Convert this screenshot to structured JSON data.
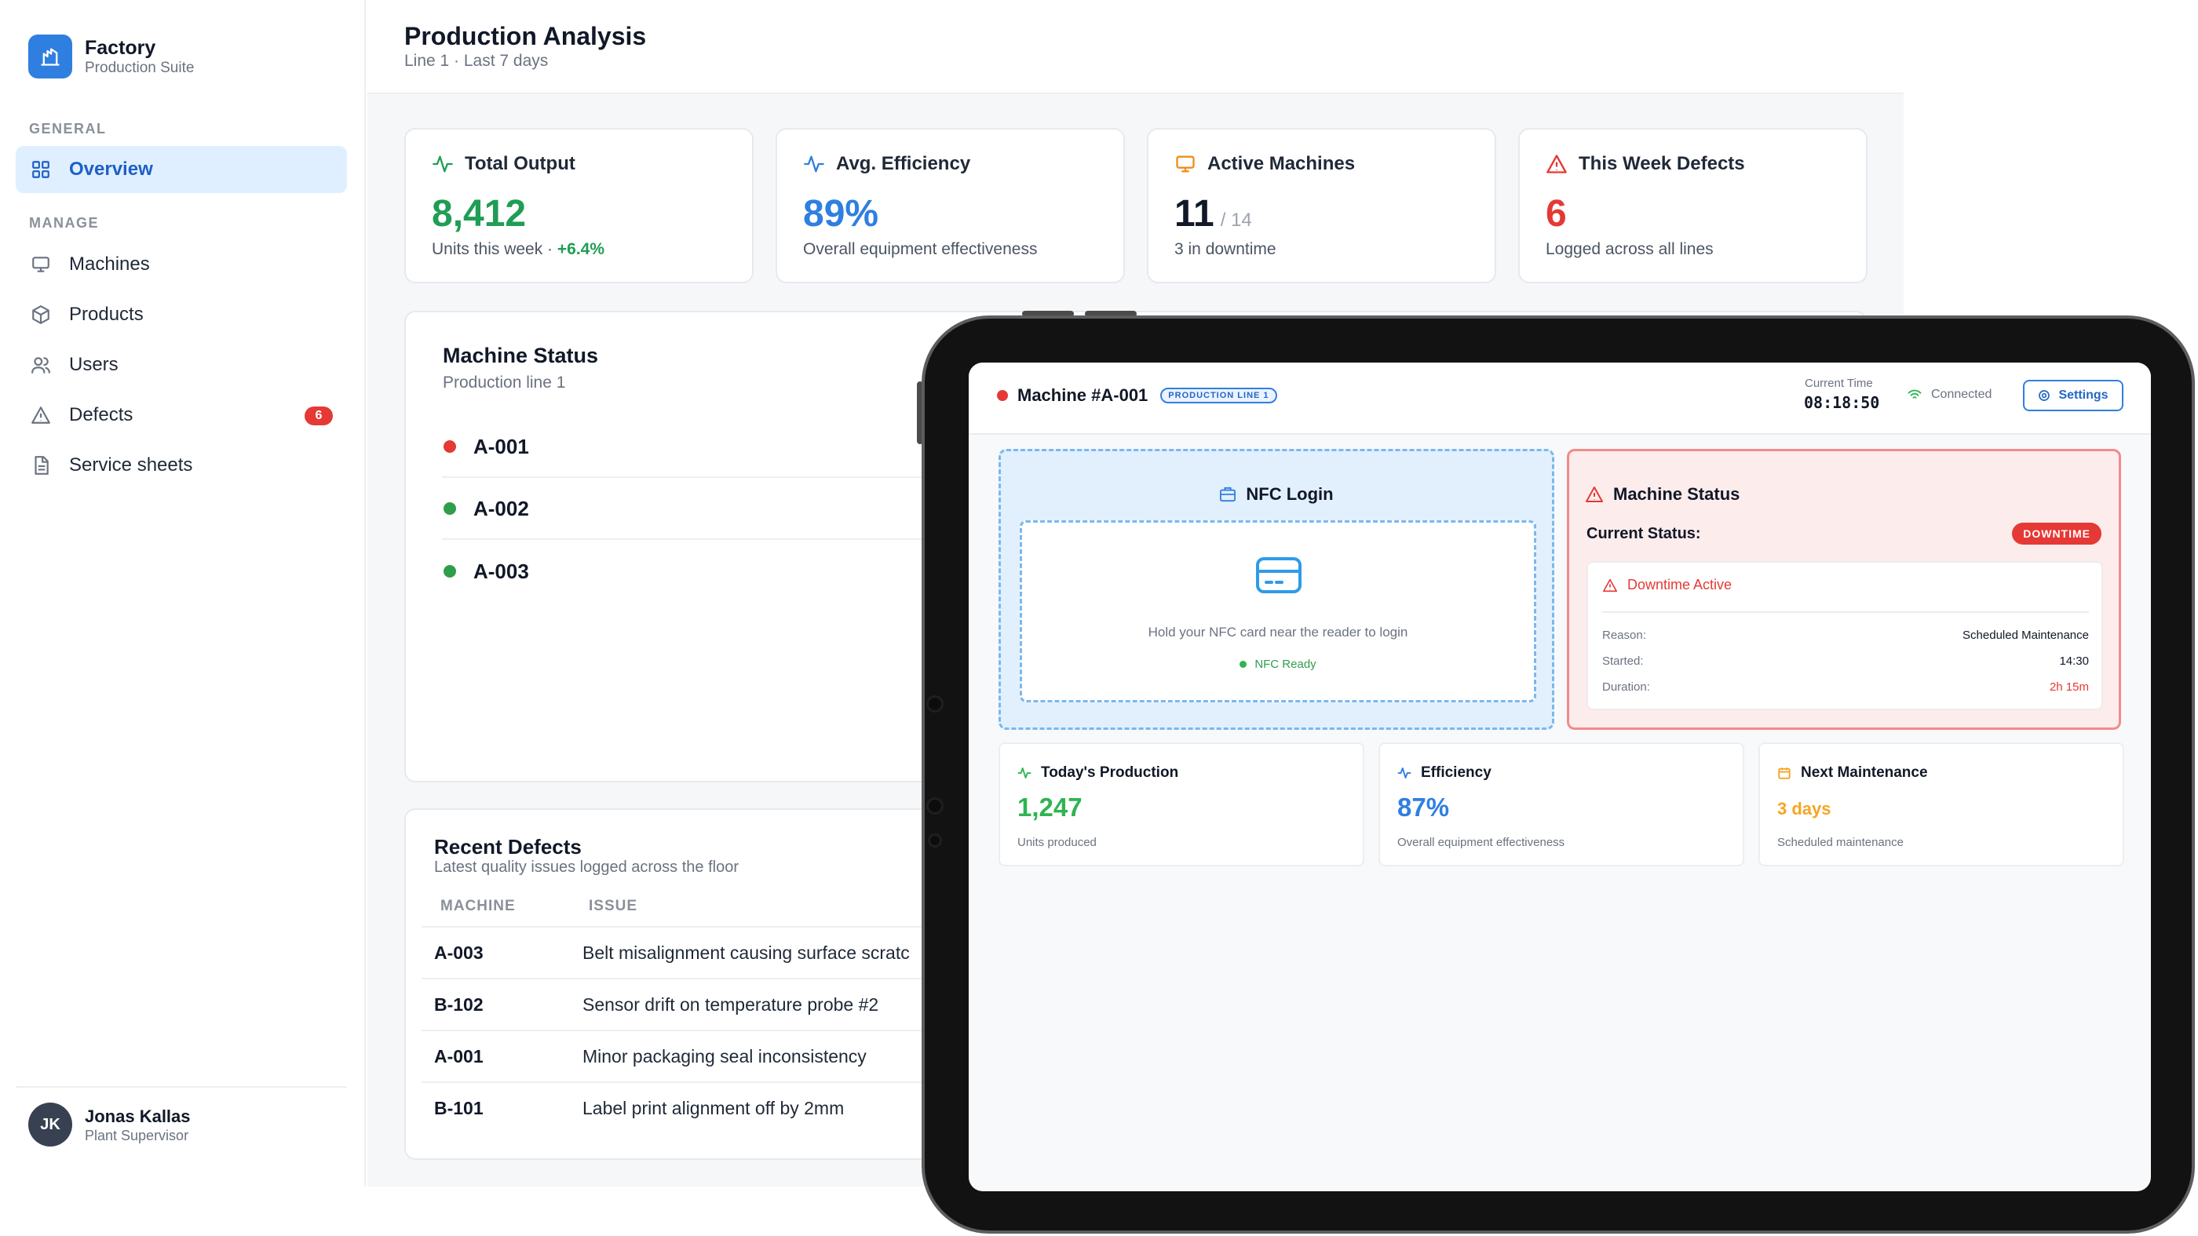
{
  "sidebar": {
    "brand": {
      "title": "Factory",
      "subtitle": "Production Suite"
    },
    "sections": {
      "general": "GENERAL",
      "manage": "MANAGE"
    },
    "items": [
      {
        "label": "Overview",
        "icon": "grid-icon",
        "active": true
      },
      {
        "label": "Machines",
        "icon": "monitor-icon"
      },
      {
        "label": "Products",
        "icon": "box-icon"
      },
      {
        "label": "Users",
        "icon": "users-icon"
      },
      {
        "label": "Defects",
        "icon": "alert-triangle-icon",
        "badge": "6"
      },
      {
        "label": "Service sheets",
        "icon": "document-icon"
      }
    ],
    "user": {
      "initials": "JK",
      "name": "Jonas Kallas",
      "role": "Plant Supervisor"
    }
  },
  "header": {
    "title": "Production Analysis",
    "subtitle": "Line 1 · Last 7 days"
  },
  "stats": [
    {
      "label": "Total Output",
      "icon": "activity-icon",
      "value": "8,412",
      "value_color": "#1f9d55",
      "foot": "Units this week · ",
      "foot_highlight": "+6.4%"
    },
    {
      "label": "Avg. Efficiency",
      "icon": "activity-icon",
      "value": "89%",
      "value_color": "#2f7fe0",
      "foot": "Overall equipment effectiveness"
    },
    {
      "label": "Active Machines",
      "icon": "monitor-icon",
      "value": "11",
      "value_of": "/ 14",
      "value_color": "#111827",
      "foot": "3 in downtime"
    },
    {
      "label": "This Week Defects",
      "icon": "alert-triangle-icon",
      "value": "6",
      "value_color": "#e53935",
      "foot": "Logged across all lines"
    }
  ],
  "machine_status": {
    "title": "Machine Status",
    "subtitle": "Production line 1",
    "rows": [
      {
        "id": "A-001",
        "status_color": "#e53935"
      },
      {
        "id": "A-002",
        "status_color": "#2f9e4a"
      },
      {
        "id": "A-003",
        "status_color": "#2f9e4a"
      }
    ]
  },
  "recent_defects": {
    "title": "Recent Defects",
    "subtitle": "Latest quality issues logged across the floor",
    "columns": [
      "MACHINE",
      "ISSUE"
    ],
    "rows": [
      {
        "machine": "A-003",
        "issue": "Belt misalignment causing surface scratc"
      },
      {
        "machine": "B-102",
        "issue": "Sensor drift on temperature probe #2"
      },
      {
        "machine": "A-001",
        "issue": "Minor packaging seal inconsistency"
      },
      {
        "machine": "B-101",
        "issue": "Label print alignment off by 2mm"
      }
    ]
  },
  "tablet": {
    "machine": "Machine #A-001",
    "line_pill": "PRODUCTION LINE 1",
    "time_label": "Current Time",
    "time": "08:18:50",
    "connection": "Connected",
    "settings": "Settings",
    "nfc": {
      "title": "NFC Login",
      "hint": "Hold your NFC card near the reader to login",
      "ready": "NFC Ready"
    },
    "status": {
      "title": "Machine Status",
      "current_label": "Current Status:",
      "badge": "DOWNTIME",
      "downtime_title": "Downtime Active",
      "rows": [
        {
          "key": "Reason:",
          "value": "Scheduled Maintenance"
        },
        {
          "key": "Started:",
          "value": "14:30"
        },
        {
          "key": "Duration:",
          "value": "2h 15m"
        }
      ]
    },
    "kpis": [
      {
        "title": "Today's Production",
        "icon": "activity-icon",
        "value": "1,247",
        "value_color": "#2fb452",
        "sub": "Units produced"
      },
      {
        "title": "Efficiency",
        "icon": "activity-icon",
        "value": "87%",
        "value_color": "#2f7fe0",
        "sub": "Overall equipment effectiveness"
      },
      {
        "title": "Next Maintenance",
        "icon": "calendar-icon",
        "value": "3 days",
        "value_color": "#f5a524",
        "sub": "Scheduled maintenance"
      }
    ]
  },
  "colors": {
    "accent": "#2f7fe0",
    "danger": "#e53935",
    "success": "#2f9e4a",
    "warning": "#f5a524"
  }
}
